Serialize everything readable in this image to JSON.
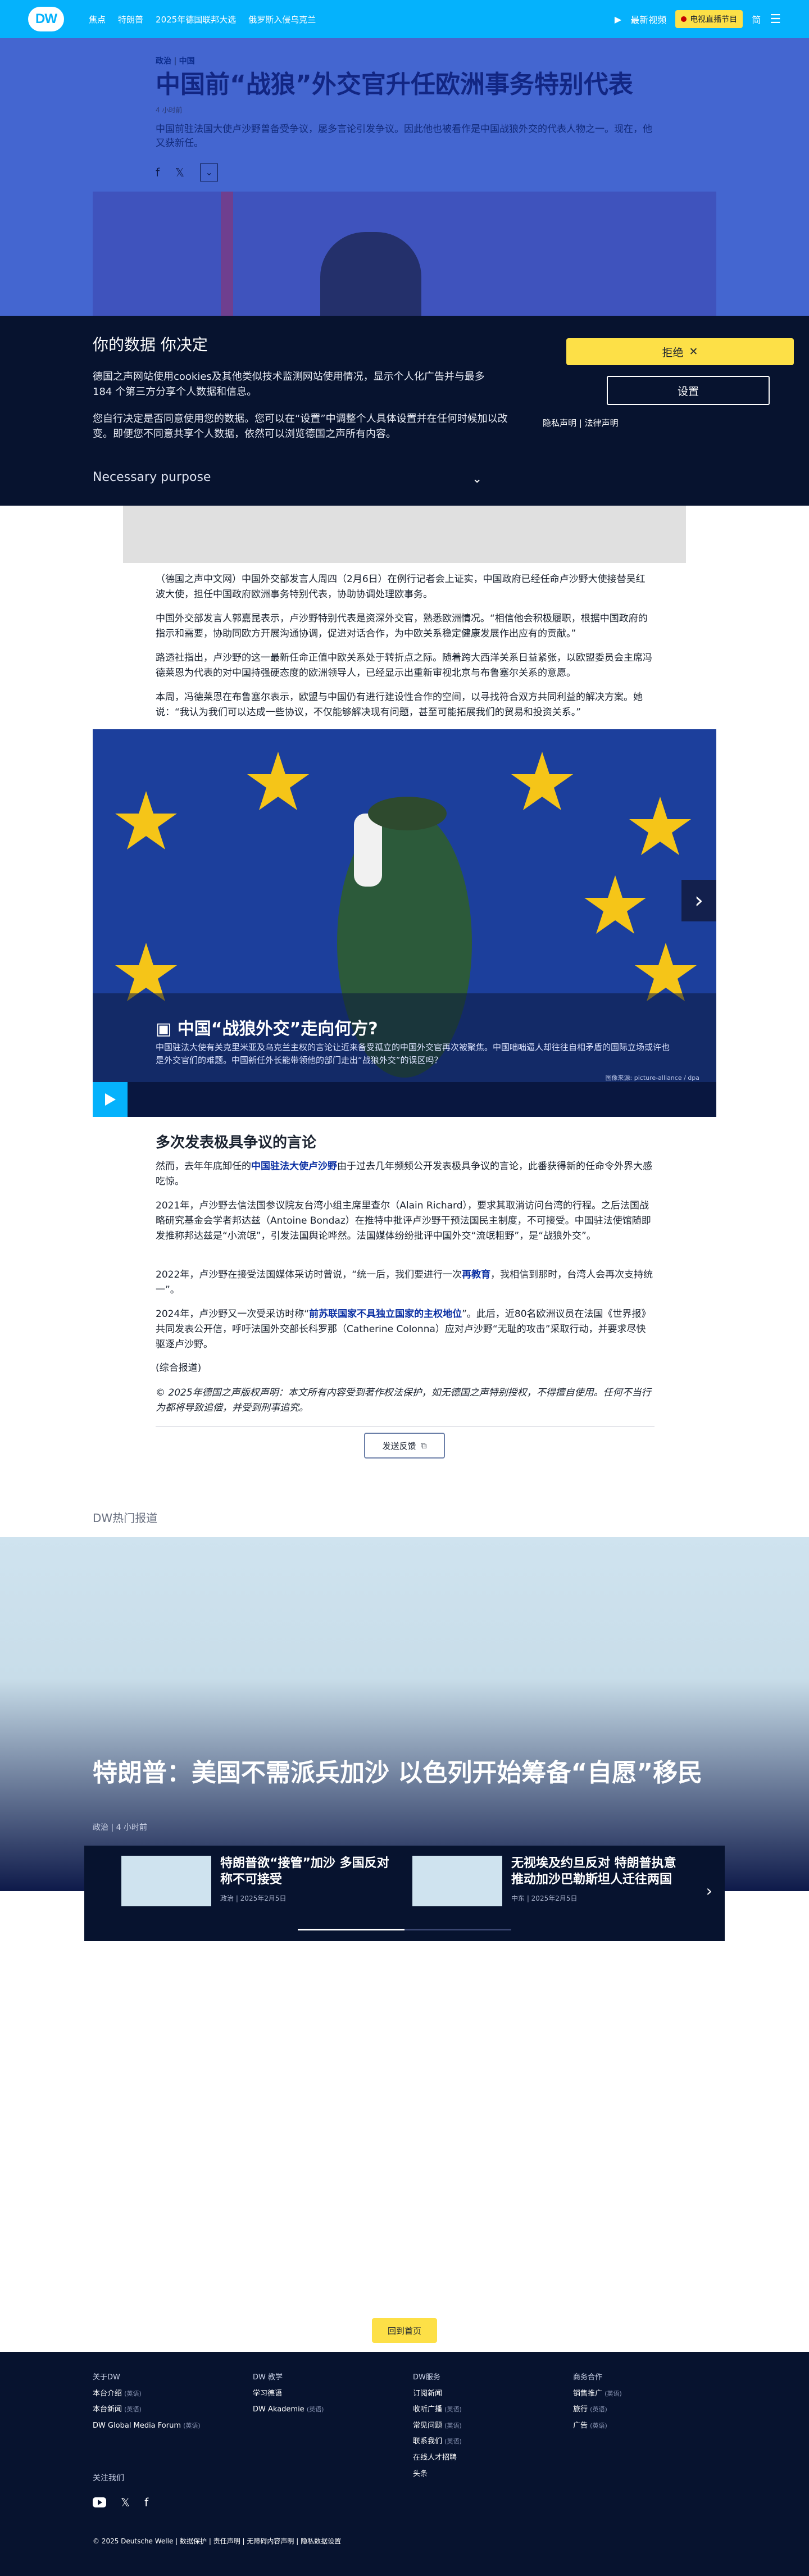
{
  "header": {
    "logo": "DW",
    "nav": [
      "焦点",
      "特朗普",
      "2025年德国联邦大选",
      "俄罗斯入侵乌克兰"
    ],
    "latest_video": "最新视频",
    "live_tv": "电视直播节目",
    "lang": "简"
  },
  "article": {
    "kicker_section": "政治",
    "kicker_region": "中国",
    "title": "中国前“战狼”外交官升任欧洲事务特别代表",
    "time": "4 小时前",
    "lead": "中国前驻法国大使卢沙野曾备受争议，屡多言论引发争议。因此他也被看作是中国战狼外交的代表人物之一。现在，他又获新任。",
    "p1": "（德国之声中文网）中国外交部发言人周四（2月6日）在例行记者会上证实，中国政府已经任命卢沙野大使接替吴红波大使，担任中国政府欧洲事务特别代表，协助协调处理欧事务。",
    "p2": "中国外交部发言人郭嘉昆表示，卢沙野特别代表是资深外交官，熟悉欧洲情况。“相信他会积极履职，根据中国政府的指示和需要，协助同欧方开展沟通协调，促进对话合作，为中欧关系稳定健康发展作出应有的贡献。”",
    "p3": "路透社指出，卢沙野的这一最新任命正值中欧关系处于转折点之际。随着跨大西洋关系日益紧张，以欧盟委员会主席冯德莱恩为代表的对中国持强硬态度的欧洲领导人，已经显示出重新审视北京与布鲁塞尔关系的意愿。",
    "p4": "本周，冯德莱恩在布鲁塞尔表示，欧盟与中国仍有进行建设性合作的空间，以寻找符合双方共同利益的解决方案。她说：“我认为我们可以达成一些协议，不仅能够解决现有问题，甚至可能拓展我们的贸易和投资关系。”",
    "gallery_title": "中国“战狼外交”走向何方?",
    "gallery_text": "中国驻法大使有关克里米亚及乌克兰主权的言论让近来备受孤立的中国外交官再次被聚焦。中国咄咄逼人却往往自相矛盾的国际立场或许也是外交官们的难题。中国新任外长能带领他的部门走出“战狼外交”的误区吗？",
    "gallery_credit": "图像来源: picture-alliance / dpa",
    "h2": "多次发表极具争议的言论",
    "p5a": "然而，去年年底卸任的",
    "p5link": "中国驻法大使卢沙野",
    "p5b": "由于过去几年频频公开发表极具争议的言论，此番获得新的任命令外界大感吃惊。",
    "p6": "2021年，卢沙野去信法国参议院友台湾小组主席里查尔（Alain Richard），要求其取消访问台湾的行程。之后法国战略研究基金会学者邦达兹（Antoine Bondaz）在推特中批评卢沙野干预法国民主制度，不可接受。中国驻法使馆随即发推称邦达兹是“小流氓”，引发法国舆论哗然。法国媒体纷纷批评中国外交“流氓粗野”，是“战狼外交”。",
    "p7a": "2022年，卢沙野在接受法国媒体采访时曾说，“统一后，我们要进行一次",
    "p7link": "再教育",
    "p7b": "，我相信到那时，台湾人会再次支持统一”。",
    "p8a": "2024年，卢沙野又一次受采访时称“",
    "p8link": "前苏联国家不具独立国家的主权地位",
    "p8b": "”。此后，近80名欧洲议员在法国《世界报》共同发表公开信，呼吁法国外交部长科罗那（Catherine Colonna）应对卢沙野“无耻的攻击”采取行动，并要求尽快驱逐卢沙野。",
    "p9": "(综合报道)",
    "copyright": "© 2025年德国之声版权声明：本文所有内容受到著作权法保护，如无德国之声特别授权，不得擅自使用。任何不当行为都将导致追偿，并受到刑事追究。",
    "feedback": "发送反馈"
  },
  "consent": {
    "title": "你的数据 你决定",
    "p1": "德国之声网站使用cookies及其他类似技术监测网站使用情况，显示个人化广告并与最多184 个第三方分享个人数据和信息。",
    "p2": "您自行决定是否同意使用您的数据。您可以在“设置”中调整个人具体设置并在任何时候加以改变。即便您不同意共享个人数据，依然可以浏览德国之声所有内容。",
    "necessary": "Necessary purpose",
    "reject": "拒绝",
    "settings": "设置",
    "privacy": "隐私声明",
    "legal": "法律声明"
  },
  "trending": {
    "title": "DW热门报道",
    "story_title": "特朗普：美国不需派兵加沙 以色列开始筹备“自愿”移民",
    "story_meta": "政治 | 4 小时前",
    "teasers": [
      {
        "title": "特朗普欲“接管”加沙 多国反对称不可接受",
        "meta": "政治 | 2025年2月5日"
      },
      {
        "title": "无视埃及约旦反对 特朗普执意推动加沙巴勒斯坦人迁往两国",
        "meta": "中东 | 2025年2月5日"
      }
    ]
  },
  "totop": "回到首页",
  "footer": {
    "cols": [
      {
        "title": "关于DW",
        "items": [
          {
            "t": "本台介绍",
            "s": "(英语)"
          },
          {
            "t": "本台新闻",
            "s": "(英语)"
          },
          {
            "t": "DW Global Media Forum",
            "s": "(英语)"
          }
        ]
      },
      {
        "title": "DW 教学",
        "items": [
          {
            "t": "学习德语",
            "s": ""
          },
          {
            "t": "DW Akademie",
            "s": "(英语)"
          }
        ]
      },
      {
        "title": "DW服务",
        "items": [
          {
            "t": "订阅新闻",
            "s": ""
          },
          {
            "t": "收听广播",
            "s": "(英语)"
          },
          {
            "t": "常见问题",
            "s": "(英语)"
          },
          {
            "t": "联系我们",
            "s": "(英语)"
          },
          {
            "t": "在线人才招聘",
            "s": ""
          },
          {
            "t": "头条",
            "s": ""
          }
        ]
      },
      {
        "title": "商务合作",
        "items": [
          {
            "t": "销售推广",
            "s": "(英语)"
          },
          {
            "t": "旅行",
            "s": "(英语)"
          },
          {
            "t": "广告",
            "s": "(英语)"
          }
        ]
      }
    ],
    "follow": "关注我们",
    "legal": [
      "© 2025 Deutsche Welle",
      "数据保护",
      "责任声明",
      "无障碍内容声明",
      "隐私数据设置"
    ]
  }
}
